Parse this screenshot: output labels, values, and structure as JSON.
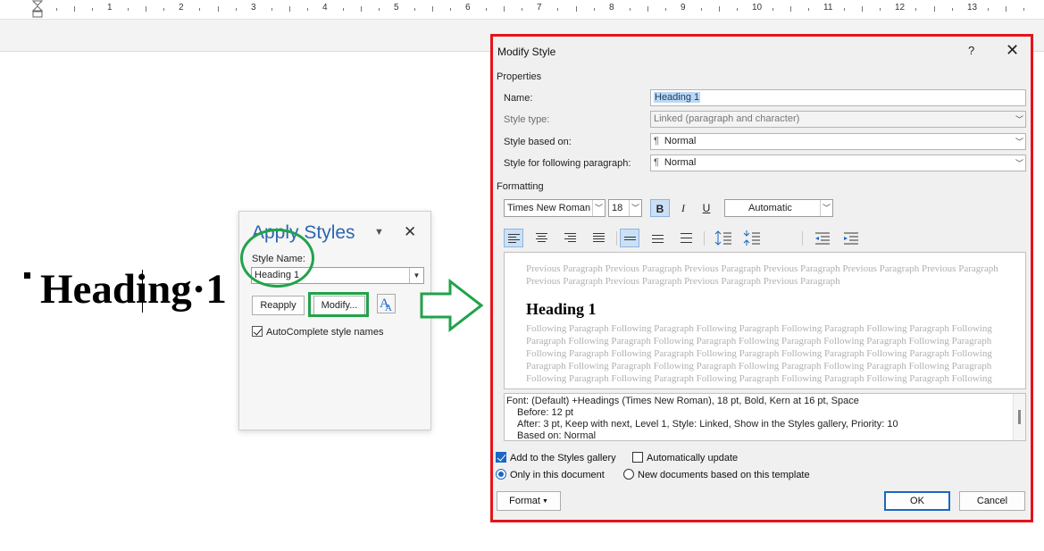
{
  "ruler": {
    "numbers": [
      "1",
      "2",
      "3",
      "4",
      "5",
      "6",
      "7",
      "8",
      "9",
      "10",
      "11",
      "12",
      "13"
    ]
  },
  "document": {
    "heading_text": "Heading·1"
  },
  "apply_styles": {
    "title": "Apply Styles",
    "style_name_label": "Style Name:",
    "style_name_value": "Heading 1",
    "reapply_label": "Reapply",
    "modify_label": "Modify...",
    "autocomplete_label": "AutoComplete style names",
    "autocomplete_checked": true
  },
  "modify_style": {
    "title": "Modify Style",
    "help_glyph": "?",
    "close_glyph": "✕",
    "properties_section": "Properties",
    "name_label": "Name:",
    "name_value": "Heading 1",
    "style_type_label": "Style type:",
    "style_type_value": "Linked (paragraph and character)",
    "based_on_label": "Style based on:",
    "based_on_value": "Normal",
    "following_label": "Style for following paragraph:",
    "following_value": "Normal",
    "formatting_section": "Formatting",
    "font": "Times New Roman",
    "size": "18",
    "bold": "B",
    "italic": "I",
    "underline": "U",
    "color": "Automatic",
    "preview": {
      "previous": "Previous Paragraph Previous Paragraph Previous Paragraph Previous Paragraph Previous Paragraph Previous Paragraph Previous Paragraph Previous Paragraph Previous Paragraph Previous Paragraph",
      "heading": "Heading 1",
      "following": "Following Paragraph Following Paragraph Following Paragraph Following Paragraph Following Paragraph Following Paragraph Following Paragraph Following Paragraph Following Paragraph Following Paragraph Following Paragraph Following Paragraph Following Paragraph Following Paragraph Following Paragraph Following Paragraph Following Paragraph Following Paragraph Following Paragraph Following Paragraph Following Paragraph Following Paragraph Following Paragraph Following Paragraph Following Paragraph Following Paragraph Following Paragraph Following Paragraph Following Paragraph Following Paragraph Following Paragraph Following Paragraph Following Paragraph Following Paragraph Following Paragraph"
    },
    "description_lines": [
      "Font: (Default) +Headings (Times New Roman), 18 pt, Bold, Kern at 16 pt, Space",
      "Before:  12 pt",
      "After:  3 pt, Keep with next, Level 1, Style: Linked, Show in the Styles gallery, Priority: 10",
      "Based on: Normal"
    ],
    "add_to_gallery_label": "Add to the Styles gallery",
    "add_to_gallery_checked": true,
    "auto_update_label": "Automatically update",
    "auto_update_checked": false,
    "only_this_doc_label": "Only in this document",
    "new_docs_label": "New documents based on this template",
    "scope_selected": "Only in this document",
    "format_label": "Format",
    "ok_label": "OK",
    "cancel_label": "Cancel"
  },
  "colors": {
    "dialog_highlight": "#e5141b",
    "annotation_green": "#22a24a",
    "accent_blue": "#1a67c4"
  }
}
